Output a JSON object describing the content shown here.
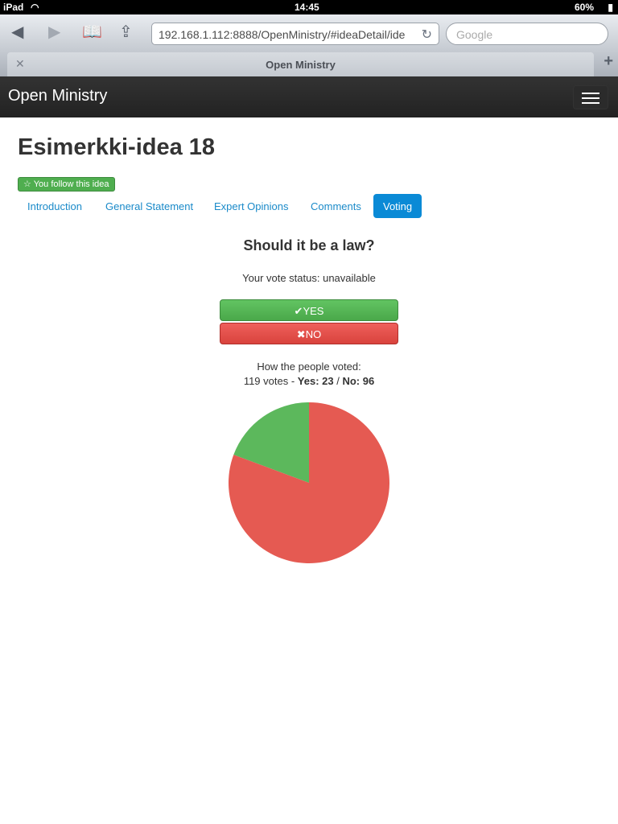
{
  "status": {
    "device": "iPad",
    "time": "14:45",
    "battery": "60%"
  },
  "browser": {
    "url": "192.168.1.112:8888/OpenMinistry/#ideaDetail/ide",
    "search_placeholder": "Google",
    "tab_title": "Open Ministry"
  },
  "app": {
    "brand": "Open Ministry"
  },
  "idea": {
    "title": "Esimerkki-idea 18",
    "follow_label": "You follow this idea"
  },
  "tabs": [
    "Introduction",
    "General Statement",
    "Expert Opinions",
    "Comments",
    "Voting"
  ],
  "vote": {
    "question": "Should it be a law?",
    "status": "Your vote status: unavailable",
    "yes_label": "YES",
    "no_label": "NO",
    "how": "How the people voted:",
    "summary_prefix": "119 votes - ",
    "yes_summary": "Yes: 23",
    "sep": " / ",
    "no_summary": "No: 96"
  },
  "chart_data": {
    "type": "pie",
    "categories": [
      "Yes",
      "No"
    ],
    "values": [
      23,
      96
    ],
    "colors": [
      "#5cb85c",
      "#e55a52"
    ]
  }
}
